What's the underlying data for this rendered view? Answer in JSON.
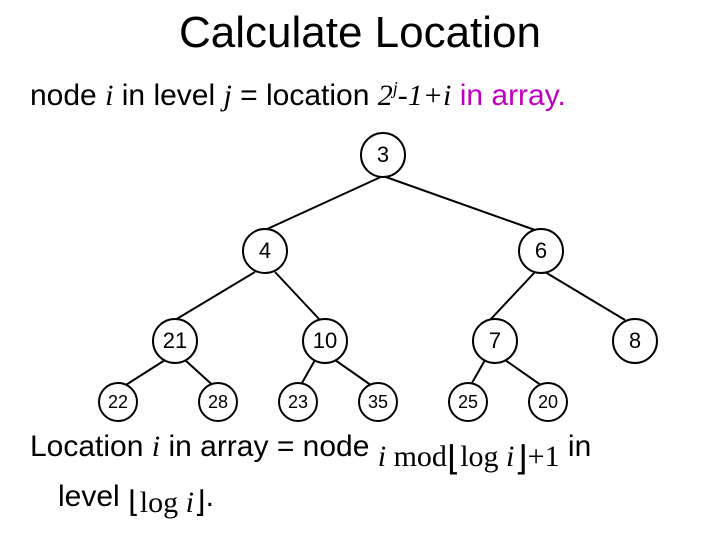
{
  "title": "Calculate Location",
  "line1": {
    "p1": "node ",
    "i": "i",
    "p2": " in level ",
    "j": "j",
    "p3": " =  location  ",
    "base": "2",
    "sup": "j",
    "mid": "-1+",
    "i2": "i",
    "end": " in array."
  },
  "tree": {
    "n0": "3",
    "n1": "4",
    "n2": "6",
    "n3": "21",
    "n4": "10",
    "n5": "7",
    "n6": "8",
    "n7": "22",
    "n8": "28",
    "n9": "23",
    "n10": "35",
    "n11": "25",
    "n12": "20"
  },
  "line2": {
    "p1": "Location ",
    "i": "i",
    "p2": " in array = node ",
    "f1a": "i",
    "f1b": " mod",
    "f1c": "log",
    "f1d": " i",
    "f1e": "+1",
    "p3": "   in",
    "p4": "level ",
    "f2a": "log",
    "f2b": " i",
    "p5": "."
  },
  "chart_data": {
    "type": "tree",
    "title": "Binary tree example for index calculation",
    "nodes": [
      {
        "id": 0,
        "value": 3,
        "level": 0,
        "children": [
          1,
          2
        ]
      },
      {
        "id": 1,
        "value": 4,
        "level": 1,
        "children": [
          3,
          4
        ]
      },
      {
        "id": 2,
        "value": 6,
        "level": 1,
        "children": [
          5,
          6
        ]
      },
      {
        "id": 3,
        "value": 21,
        "level": 2,
        "children": [
          7,
          8
        ]
      },
      {
        "id": 4,
        "value": 10,
        "level": 2,
        "children": [
          9,
          10
        ]
      },
      {
        "id": 5,
        "value": 7,
        "level": 2,
        "children": [
          11,
          12
        ]
      },
      {
        "id": 6,
        "value": 8,
        "level": 2,
        "children": []
      },
      {
        "id": 7,
        "value": 22,
        "level": 3,
        "children": []
      },
      {
        "id": 8,
        "value": 28,
        "level": 3,
        "children": []
      },
      {
        "id": 9,
        "value": 23,
        "level": 3,
        "children": []
      },
      {
        "id": 10,
        "value": 35,
        "level": 3,
        "children": []
      },
      {
        "id": 11,
        "value": 25,
        "level": 3,
        "children": []
      },
      {
        "id": 12,
        "value": 20,
        "level": 3,
        "children": []
      }
    ],
    "formula_node_to_array": "node i in level j → location 2^j - 1 + i in array",
    "formula_array_to_node": "Location i in array → node (i mod ⌊log i⌋ + 1) in level ⌊log i⌋"
  }
}
